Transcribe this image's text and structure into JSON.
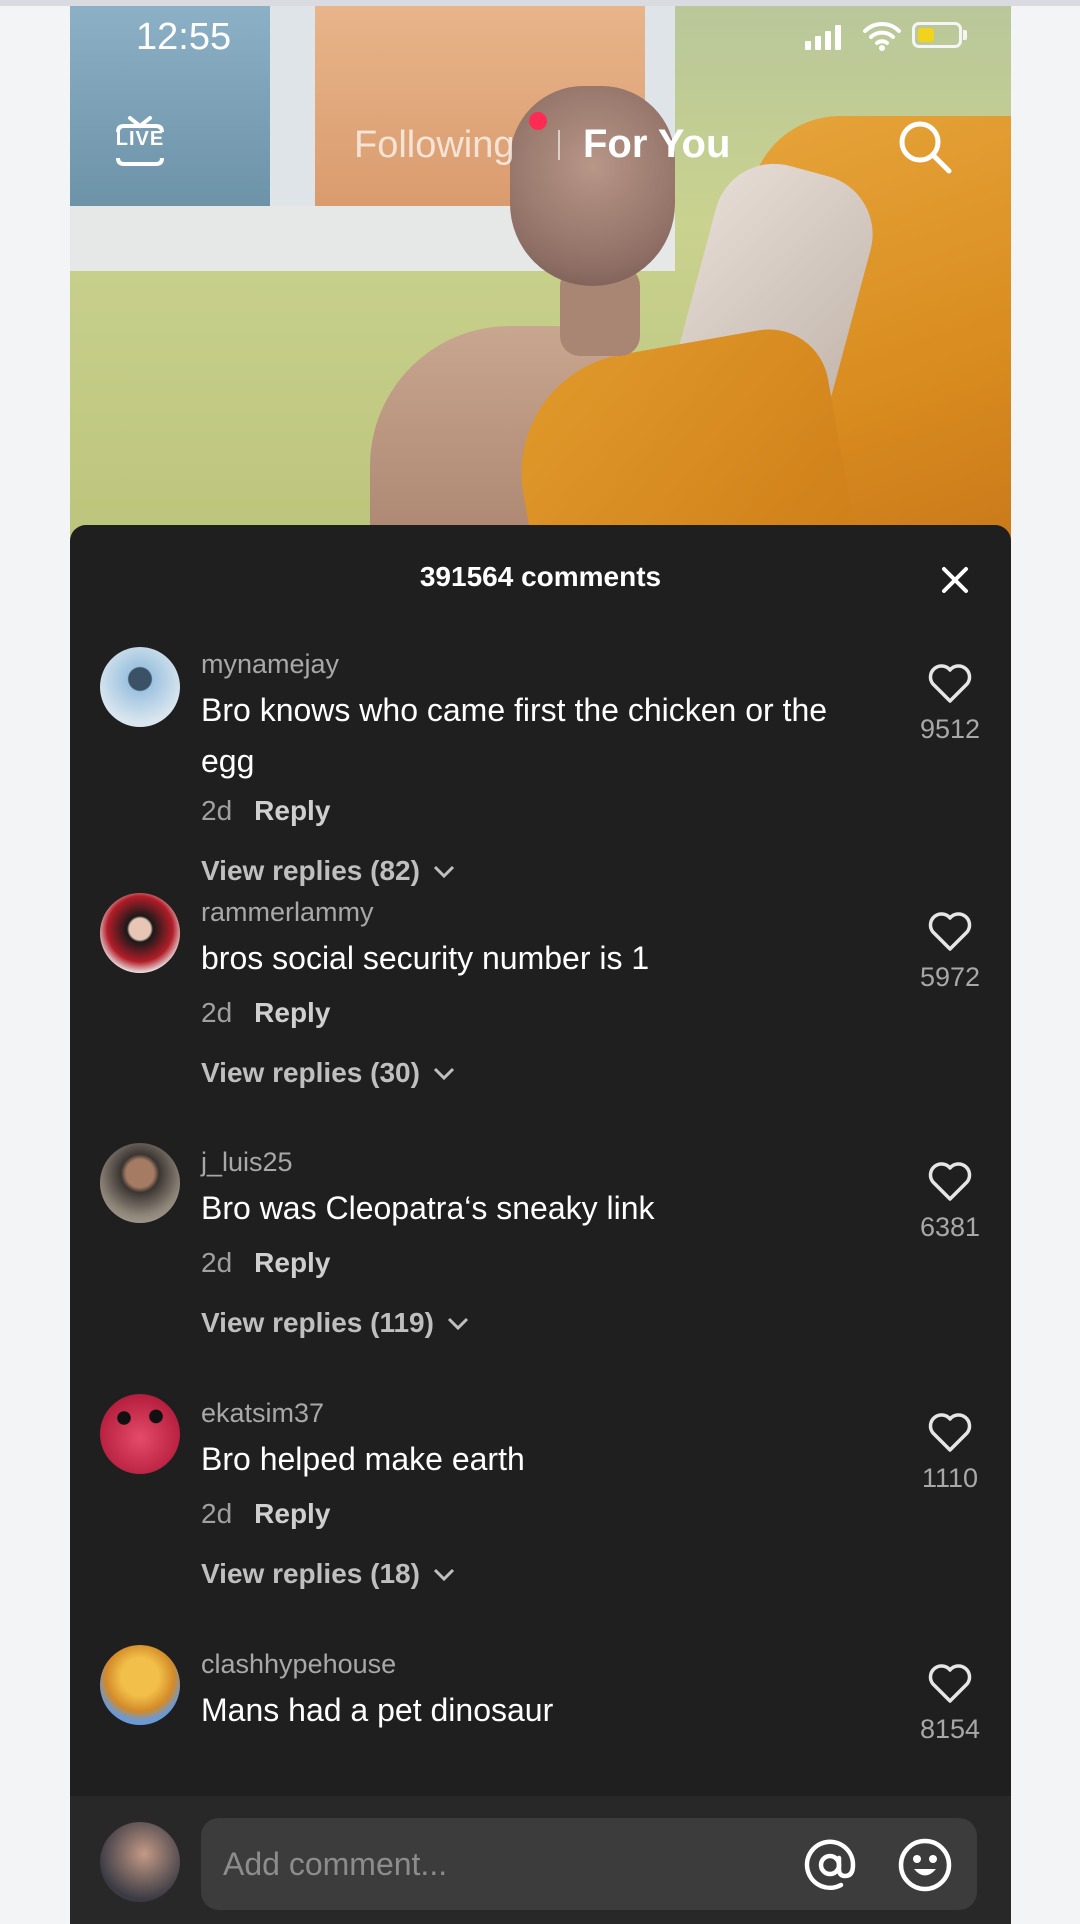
{
  "status_bar": {
    "time": "12:55"
  },
  "top_nav": {
    "live_label": "LIVE",
    "tab_following": "Following",
    "tab_for_you": "For You"
  },
  "comments_panel": {
    "title": "391564 comments",
    "comments": [
      {
        "username": "mynamejay",
        "text": "Bro knows who came first the chicken or the egg",
        "age": "2d",
        "reply_label": "Reply",
        "view_replies": "View replies (82)",
        "likes": "9512"
      },
      {
        "username": "rammerlammy",
        "text": "bros social security number is 1",
        "age": "2d",
        "reply_label": "Reply",
        "view_replies": "View replies (30)",
        "likes": "5972"
      },
      {
        "username": "j_luis25",
        "text": "Bro was Cleopatra‘s sneaky link",
        "age": "2d",
        "reply_label": "Reply",
        "view_replies": "View replies (119)",
        "likes": "6381"
      },
      {
        "username": "ekatsim37",
        "text": "Bro helped make earth",
        "age": "2d",
        "reply_label": "Reply",
        "view_replies": "View replies (18)",
        "likes": "1110"
      },
      {
        "username": "clashhypehouse",
        "text": "Mans had a pet dinosaur",
        "likes": "8154"
      }
    ]
  },
  "composer": {
    "placeholder": "Add comment..."
  },
  "icons": [
    "live-icon",
    "search-icon",
    "close-icon",
    "heart-icon",
    "chevron-down-icon",
    "at-icon",
    "emoji-icon",
    "wifi-icon",
    "battery-icon",
    "signal-icon"
  ],
  "colors": {
    "sheet_bg": "#1f1f1f",
    "accent_dot": "#fe2c55",
    "battery": "#f1d21f"
  }
}
